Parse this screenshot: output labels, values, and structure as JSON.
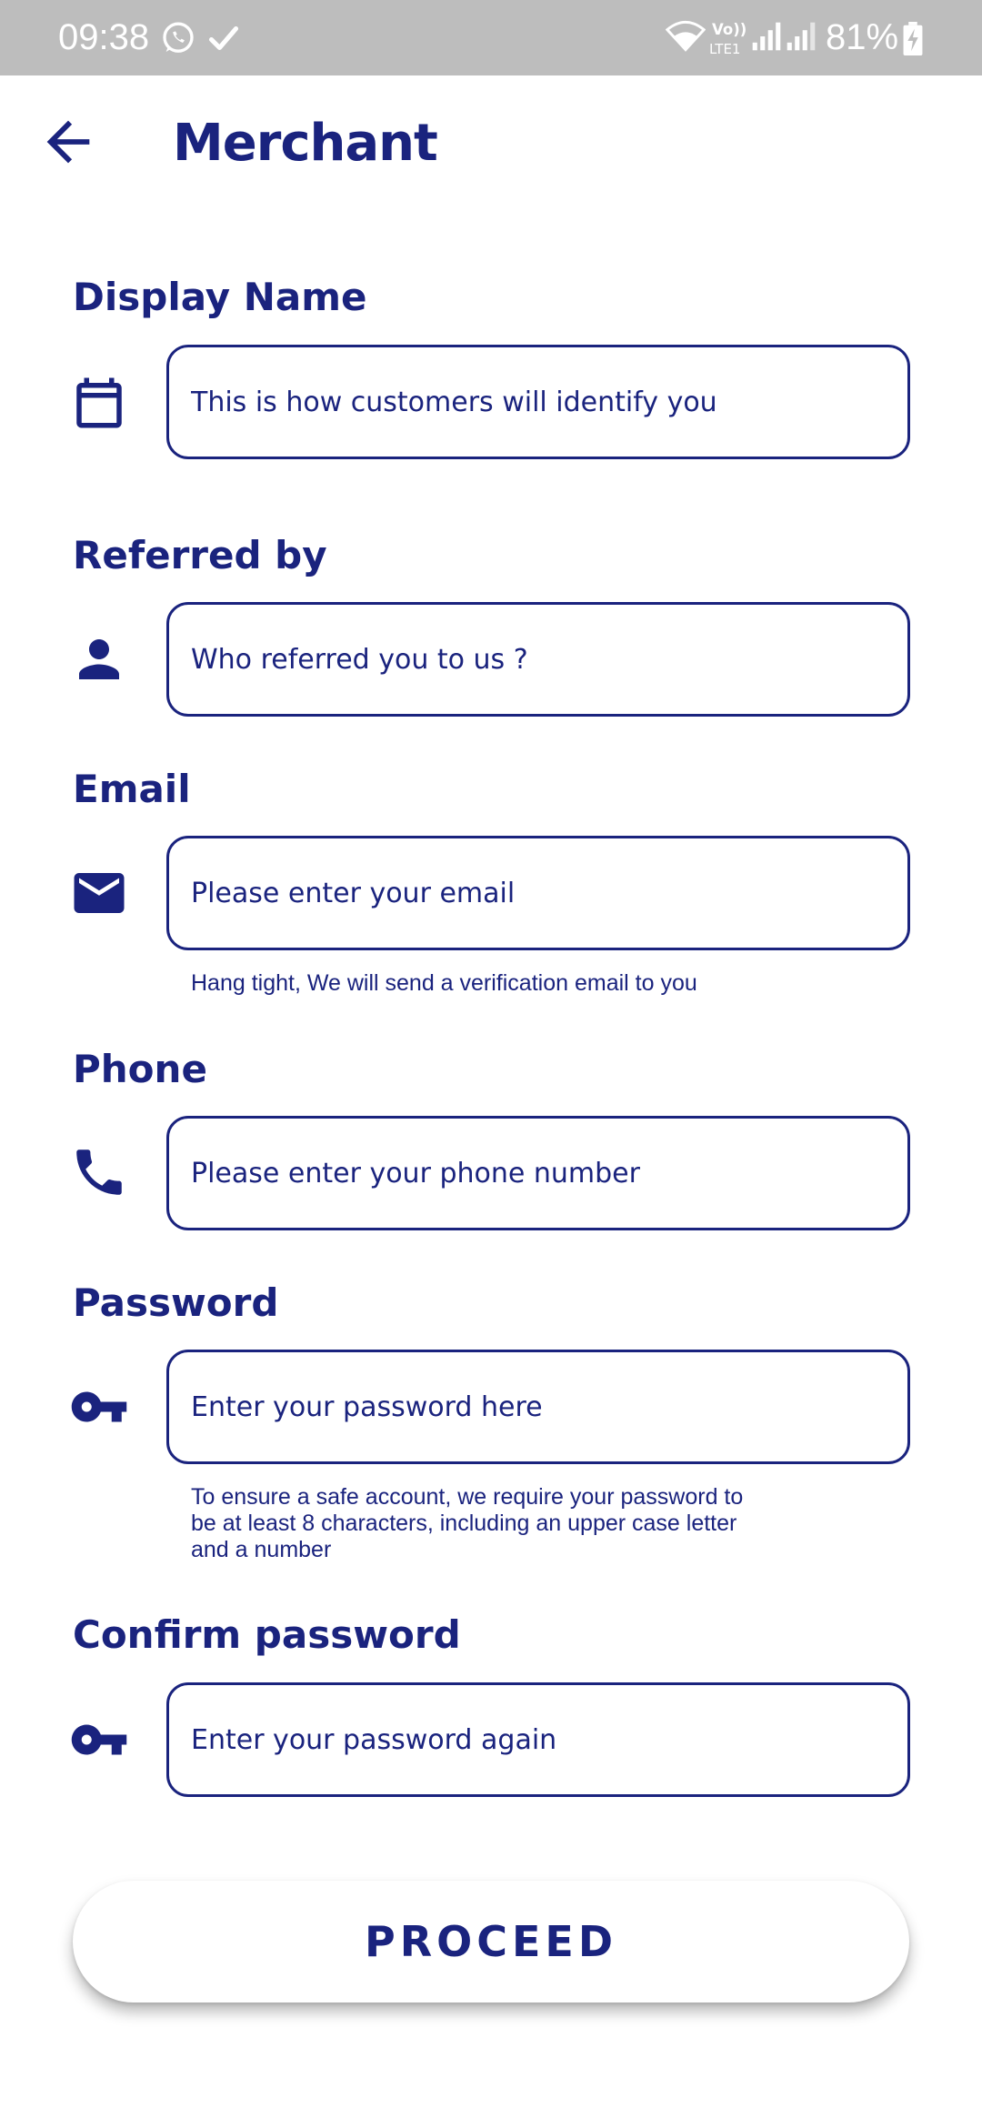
{
  "status_bar": {
    "time": "09:38",
    "battery": "81%",
    "icons": [
      "whatsapp-icon",
      "check-icon",
      "wifi-icon",
      "volte-icon",
      "signal-icon",
      "signal-icon",
      "battery-charging-icon"
    ]
  },
  "app_bar": {
    "title": "Merchant",
    "back_icon": "arrow-back-icon"
  },
  "colors": {
    "primary": "#1a237e",
    "status_bar": "#bdbdbd",
    "background": "#ffffff"
  },
  "form": {
    "display_name": {
      "label": "Display Name",
      "icon": "calendar-icon",
      "placeholder": "This is how customers will identify you",
      "value": ""
    },
    "referred_by": {
      "label": "Referred by",
      "icon": "person-icon",
      "placeholder": "Who referred you to us ?",
      "value": ""
    },
    "email": {
      "label": "Email",
      "icon": "mail-icon",
      "placeholder": "Please enter your email",
      "value": "",
      "helper": "Hang tight, We will send a verification email to you"
    },
    "phone": {
      "label": "Phone",
      "icon": "phone-icon",
      "placeholder": "Please enter your phone number",
      "value": ""
    },
    "password": {
      "label": "Password",
      "icon": "key-icon",
      "placeholder": "Enter your password here",
      "value": "",
      "helper_lines": [
        "To ensure a safe account, we require your password to",
        "be at least 8 characters, including an upper case letter",
        "and a number"
      ]
    },
    "confirm_password": {
      "label": "Confirm password",
      "icon": "key-icon",
      "placeholder": "Enter your password again",
      "value": ""
    }
  },
  "proceed_label": "PROCEED"
}
